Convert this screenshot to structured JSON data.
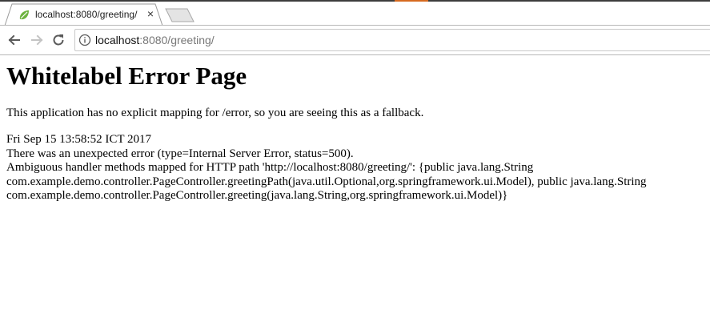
{
  "tab": {
    "title": "localhost:8080/greeting/",
    "favicon": "spring-leaf-icon",
    "close": "×"
  },
  "toolbar": {
    "url_host": "localhost",
    "url_rest": ":8080/greeting/"
  },
  "page": {
    "heading": "Whitelabel Error Page",
    "description": "This application has no explicit mapping for /error, so you are seeing this as a fallback.",
    "timestamp": "Fri Sep 15 13:58:52 ICT 2017",
    "error_line": "There was an unexpected error (type=Internal Server Error, status=500).",
    "message_lines": [
      "Ambiguous handler methods mapped for HTTP path 'http://localhost:8080/greeting/': {public java.lang.String",
      "com.example.demo.controller.PageController.greetingPath(java.util.Optional,org.springframework.ui.Model), public java.lang.String",
      "com.example.demo.controller.PageController.greeting(java.lang.String,org.springframework.ui.Model)}"
    ]
  },
  "colors": {
    "spring_green": "#6db33f",
    "accent_orange": "#d66a1f"
  }
}
